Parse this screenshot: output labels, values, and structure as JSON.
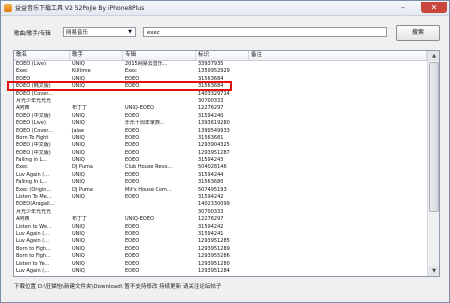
{
  "window": {
    "title": "益益音乐下载工具 V2 52Pojie By iPhone8Plus",
    "minimize_glyph": "–",
    "close_glyph": "✕"
  },
  "search": {
    "label": "歌曲/歌手/专辑",
    "source_selected": "网易音乐",
    "query": "exec",
    "button_label": "搜索"
  },
  "table": {
    "columns": [
      "歌名",
      "歌手",
      "专辑",
      "标识",
      "备注"
    ],
    "rows": [
      [
        "EOEO (Live)",
        "UNIQ",
        "2015网易云音乐...",
        "33937935",
        ""
      ],
      [
        "Exec",
        "Killtime",
        "Exec",
        "1359952929",
        ""
      ],
      [
        "EOEO",
        "UNIQ",
        "EOEO",
        "31563684",
        ""
      ],
      [
        "EOEO (韩文版)",
        "UNIQ",
        "EOEO",
        "31563684",
        ""
      ],
      [
        "EOEO (Cover...",
        "",
        "",
        "1403329714",
        ""
      ],
      [
        "月光少年光光光",
        "",
        "",
        "30700333",
        ""
      ],
      [
        "A阿西",
        "布丁丁",
        "UNIQ-EOEO",
        "12276297",
        ""
      ],
      [
        "EOEO (中文版)",
        "UNIQ",
        "EOEO",
        "31594240",
        ""
      ],
      [
        "EOEO (Live)",
        "UNIQ",
        "乐乐十周年家族...",
        "1393619280",
        ""
      ],
      [
        "EOEO (Cover...",
        "Jalae",
        "EOEO",
        "1399549933",
        ""
      ],
      [
        "Born To Fight",
        "UNIQ",
        "EOEO",
        "31563681",
        ""
      ],
      [
        "EOEO (中文版)",
        "UNIQ",
        "EOEO",
        "1293904325",
        ""
      ],
      [
        "EOEO (中文版)",
        "UNIQ",
        "EOEO",
        "1293951287",
        ""
      ],
      [
        "Falling in L...",
        "UNIQ",
        "EOEO",
        "31594243",
        ""
      ],
      [
        "Exec",
        "DJ Puma",
        "Club House Revo...",
        "504028146",
        ""
      ],
      [
        "Luv Again (...",
        "UNIQ",
        "EOEO",
        "31594244",
        ""
      ],
      [
        "Falling In L...",
        "UNIQ",
        "EOEO",
        "31563680",
        ""
      ],
      [
        "Exec (Origin...",
        "DJ Puma",
        "Mit's House Com...",
        "507495193",
        ""
      ],
      [
        "Listen To Me...",
        "UNIQ",
        "EOEO",
        "31594242",
        ""
      ],
      [
        "EOEO(Aragall...",
        "",
        "",
        "1402330099",
        ""
      ],
      [
        "月光少年光光光",
        "",
        "",
        "30700333",
        ""
      ],
      [
        "A阿西",
        "布丁丁",
        "UNIQ-EOEO",
        "12276297",
        ""
      ],
      [
        "Listen to We...",
        "UNIQ",
        "EOEO",
        "31594242",
        ""
      ],
      [
        "Luv Again (...",
        "UNIQ",
        "EOEO",
        "31594241",
        ""
      ],
      [
        "Luv Again (...",
        "UNIQ",
        "EOEO",
        "1293951285",
        ""
      ],
      [
        "Born to Figh...",
        "UNIQ",
        "EOEO",
        "1293951289",
        ""
      ],
      [
        "Born to Figh...",
        "UNIQ",
        "EOEO",
        "1293955286",
        ""
      ],
      [
        "Listen to Ye...",
        "UNIQ",
        "EOEO",
        "1293951280",
        ""
      ],
      [
        "Luv Again (...",
        "UNIQ",
        "EOEO",
        "1293951284",
        ""
      ]
    ],
    "highlighted_row_index": 3
  },
  "scrollbar": {
    "up_glyph": "▲",
    "down_glyph": "▼"
  },
  "status_bar": {
    "text": "下载位置 D:\\狂猫怡\\新建文件夹\\Download\\ 暂不支持修改  持续更新 请关注论坛帖子"
  },
  "colors": {
    "highlight_border": "#e21010",
    "close_button": "#c9463d"
  }
}
